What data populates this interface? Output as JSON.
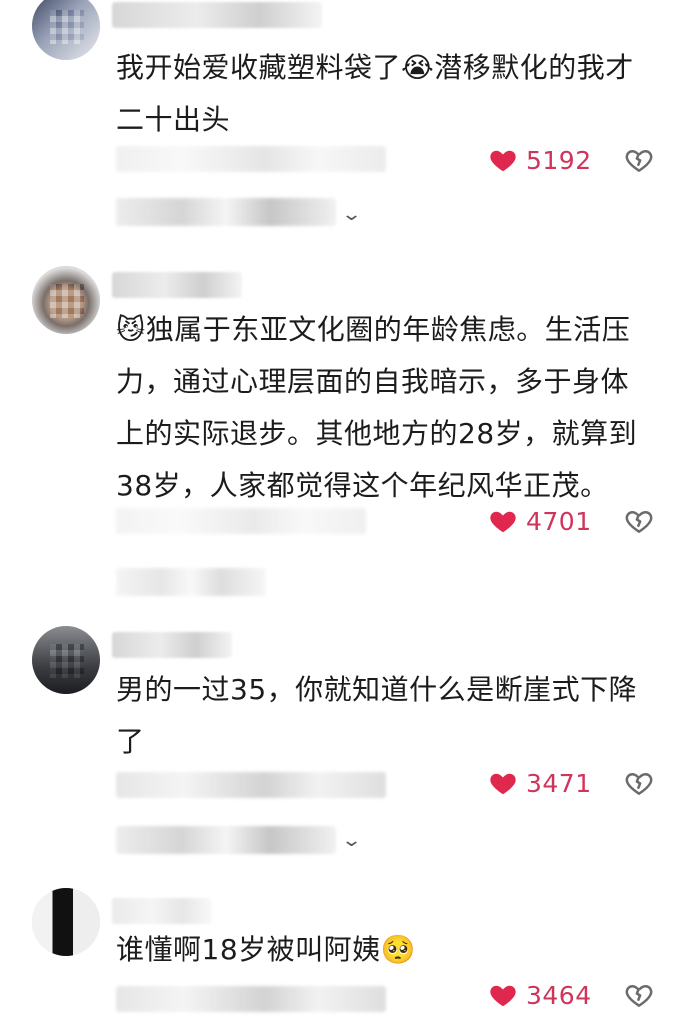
{
  "comments": [
    {
      "text": "我开始爱收藏塑料袋了😭潜移默化的我才二十出头",
      "likes": "5192",
      "expand_suffix": "复"
    },
    {
      "text": "😼独属于东亚文化圈的年龄焦虑。生活压力，通过心理层面的自我暗示，多于身体上的实际退步。其他地方的28岁，就算到38岁，人家都觉得这个年纪风华正茂。",
      "likes": "4701"
    },
    {
      "text": "男的一过35，你就知道什么是断崖式下降了",
      "likes": "3471",
      "expand_suffix": "复"
    },
    {
      "text": "谁懂啊18岁被叫阿姨🥺",
      "likes": "3464"
    }
  ],
  "colors": {
    "like_accent": "#d1345b",
    "text": "#1c1c1c",
    "icon_grey": "#6b6b6b"
  },
  "icons": {
    "like": "heart-filled-icon",
    "dislike": "broken-heart-icon",
    "expand": "chevron-down-icon"
  }
}
